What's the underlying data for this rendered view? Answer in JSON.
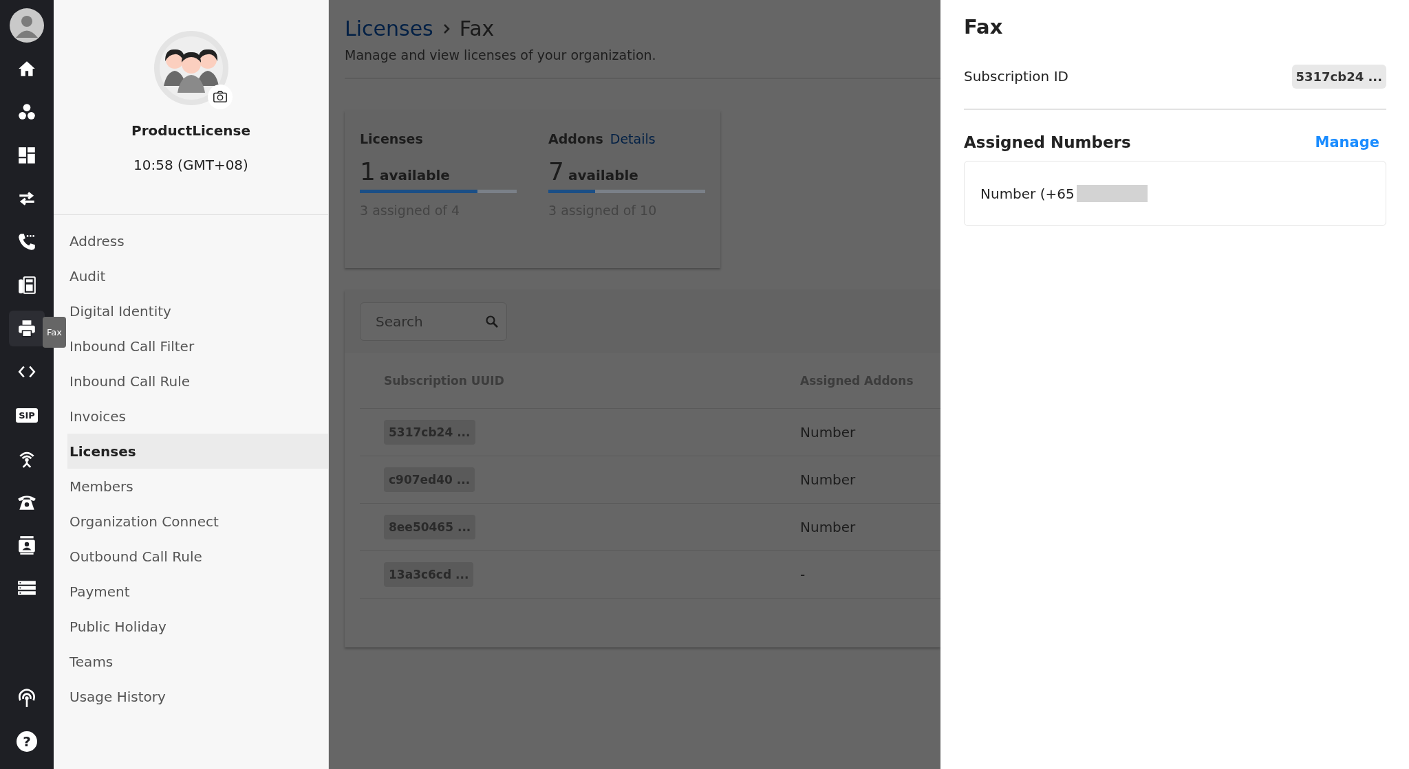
{
  "rail": {
    "items": [
      {
        "selected": false
      },
      {
        "selected": false
      },
      {
        "selected": false
      },
      {
        "selected": false
      },
      {
        "selected": false
      },
      {
        "selected": false
      },
      {
        "selected": true
      },
      {
        "selected": false
      },
      {
        "selected": false,
        "label": "SIP"
      },
      {
        "selected": false
      },
      {
        "selected": false
      },
      {
        "selected": false
      },
      {
        "selected": false
      }
    ],
    "bottom_items": [
      {
        "selected": false
      },
      {
        "selected": false,
        "label": "?"
      }
    ],
    "tooltip": "Fax"
  },
  "profile": {
    "name": "ProductLicense",
    "time": "10:58 (GMT+08)"
  },
  "nav": [
    {
      "label": "Address",
      "selected": false
    },
    {
      "label": "Audit",
      "selected": false
    },
    {
      "label": "Digital Identity",
      "selected": false
    },
    {
      "label": "Inbound Call Filter",
      "selected": false
    },
    {
      "label": "Inbound Call Rule",
      "selected": false
    },
    {
      "label": "Invoices",
      "selected": false
    },
    {
      "label": "Licenses",
      "selected": true
    },
    {
      "label": "Members",
      "selected": false
    },
    {
      "label": "Organization Connect",
      "selected": false
    },
    {
      "label": "Outbound Call Rule",
      "selected": false
    },
    {
      "label": "Payment",
      "selected": false
    },
    {
      "label": "Public Holiday",
      "selected": false
    },
    {
      "label": "Teams",
      "selected": false
    },
    {
      "label": "Usage History",
      "selected": false
    }
  ],
  "breadcrumb": {
    "parent": "Licenses",
    "current": "Fax"
  },
  "subtitle": "Manage and view licenses of your organization.",
  "summary": [
    {
      "title": "Licenses",
      "count": "1",
      "unit": "available",
      "level": 0.75,
      "caption": "3 assigned of 4"
    },
    {
      "title": "Addons",
      "link": "Details",
      "count": "7",
      "unit": "available",
      "level": 0.3,
      "caption": "3 assigned of 10"
    }
  ],
  "search": {
    "placeholder": "Search"
  },
  "table": {
    "columns": [
      "Subscription UUID",
      "Assigned Addons"
    ],
    "rows": [
      [
        "5317cb24 ...",
        "Number"
      ],
      [
        "c907ed40 ...",
        "Number"
      ],
      [
        "8ee50465 ...",
        "Number"
      ],
      [
        "13a3c6cd ...",
        "-"
      ]
    ]
  },
  "panel": {
    "title": "Fax",
    "fields": [
      {
        "label": "Subscription ID",
        "value": "5317cb24 ..."
      }
    ],
    "section": {
      "title": "Assigned Numbers",
      "action": "Manage",
      "numbers": [
        "Number (+65"
      ]
    }
  }
}
